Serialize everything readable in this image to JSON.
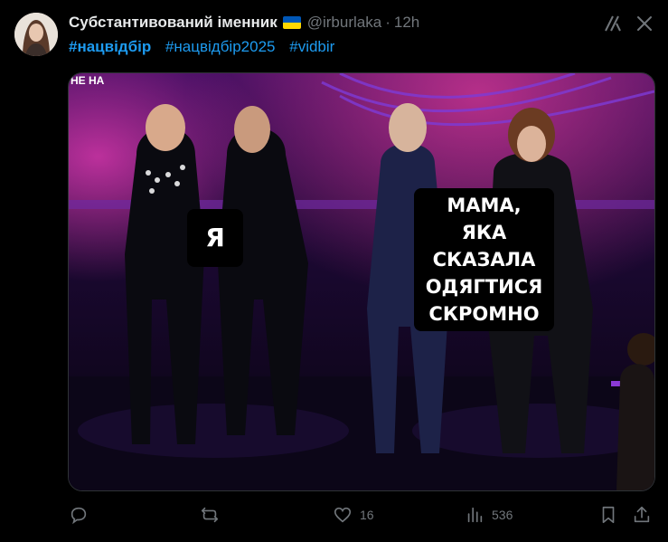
{
  "author": {
    "display_name": "Субстантивований іменник",
    "handle": "@irburlaka",
    "separator": "·",
    "time": "12h"
  },
  "hashtags": [
    "#нацвідбір",
    "#нацвідбір2025",
    "#vidbir"
  ],
  "media": {
    "corner_logo": "НЕ НА",
    "caption_left": "Я",
    "caption_right_lines": [
      "МАМА,",
      "ЯКА",
      "СКАЗАЛА",
      "ОДЯГТИСЯ",
      "СКРОМНО"
    ]
  },
  "actions": {
    "reply_count": "",
    "retweet_count": "",
    "like_count": "16",
    "view_count": "536"
  },
  "colors": {
    "background": "#000000",
    "text": "#e7e9ea",
    "secondary": "#71767b",
    "link": "#1d9bf0",
    "flag_blue": "#0057b7",
    "flag_yellow": "#ffd700"
  },
  "icons": [
    "grok-icon",
    "more-icon",
    "reply-icon",
    "retweet-icon",
    "like-icon",
    "views-icon",
    "bookmark-icon",
    "share-icon"
  ]
}
